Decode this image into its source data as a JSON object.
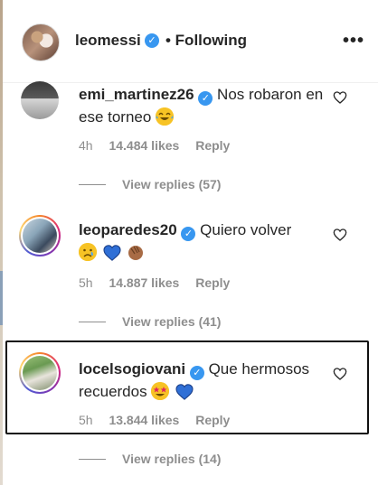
{
  "header": {
    "username": "leomessi",
    "verified_icon": "verified-badge-icon",
    "following_label": "• Following",
    "more_icon": "more-options-icon",
    "more_label": "•••"
  },
  "comments": [
    {
      "username": "emi_martinez26",
      "text": "Nos robaron en ese torneo",
      "emojis": [
        "laughing-tears-emoji"
      ],
      "time": "4h",
      "likes": "14.484 likes",
      "reply_label": "Reply",
      "view_replies": "View replies (57)"
    },
    {
      "username": "leoparedes20",
      "text": "Quiero volver",
      "emojis": [
        "sad-face-emoji",
        "blue-heart-emoji",
        "clapping-hands-emoji"
      ],
      "time": "5h",
      "likes": "14.887 likes",
      "reply_label": "Reply",
      "view_replies": "View replies (41)"
    },
    {
      "username": "locelsogiovani",
      "text": "Que hermosos recuerdos",
      "emojis": [
        "star-struck-emoji",
        "blue-heart-emoji"
      ],
      "time": "5h",
      "likes": "13.844 likes",
      "reply_label": "Reply",
      "view_replies": "View replies (14)"
    }
  ],
  "colors": {
    "verified": "#3897f0",
    "meta_text": "#8e8e8e",
    "text": "#262626",
    "blue_heart": "#2f6fd6"
  }
}
